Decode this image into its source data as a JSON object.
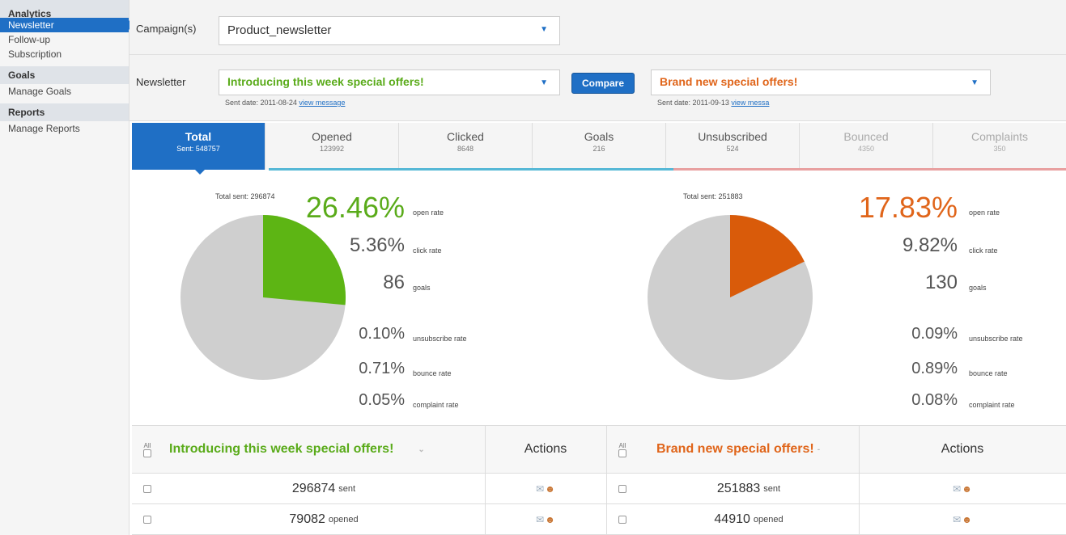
{
  "sidebar": {
    "analytics": "Analytics",
    "analytics_items": [
      "Newsletter",
      "Follow-up",
      "Subscription"
    ],
    "goals": "Goals",
    "goals_items": [
      "Manage Goals"
    ],
    "reports": "Reports",
    "reports_items": [
      "Manage Reports"
    ]
  },
  "campaign": {
    "label": "Campaign(s)",
    "value": "Product_newsletter"
  },
  "newsletter": {
    "label": "Newsletter",
    "left": {
      "value": "Introducing this week special offers!",
      "sent_date": "Sent date: 2011-08-24",
      "view": "view message"
    },
    "compare": "Compare",
    "right": {
      "value": "Brand new special offers!",
      "sent_date": "Sent date: 2011-09-13",
      "view": "view messa"
    }
  },
  "tabs": [
    {
      "label": "Total",
      "sub": "Sent: 548757"
    },
    {
      "label": "Opened",
      "sub": "123992"
    },
    {
      "label": "Clicked",
      "sub": "8648"
    },
    {
      "label": "Goals",
      "sub": "216"
    },
    {
      "label": "Unsubscribed",
      "sub": "524"
    },
    {
      "label": "Bounced",
      "sub": "4350"
    },
    {
      "label": "Complaints",
      "sub": "350"
    }
  ],
  "left_stats": {
    "total_sent": "Total sent: 296874",
    "open_rate": "26.46%",
    "open_rate_label": "open rate",
    "click_rate": "5.36%",
    "click_rate_label": "click rate",
    "goals": "86",
    "goals_label": "goals",
    "unsub_rate": "0.10%",
    "unsub_rate_label": "unsubscribe rate",
    "bounce_rate": "0.71%",
    "bounce_rate_label": "bounce rate",
    "complaint_rate": "0.05%",
    "complaint_rate_label": "complaint rate",
    "pie_fraction": 0.2646,
    "pie_color": "#5db514"
  },
  "right_stats": {
    "total_sent": "Total sent: 251883",
    "open_rate": "17.83%",
    "open_rate_label": "open rate",
    "click_rate": "9.82%",
    "click_rate_label": "click rate",
    "goals": "130",
    "goals_label": "goals",
    "unsub_rate": "0.09%",
    "unsub_rate_label": "unsubscribe rate",
    "bounce_rate": "0.89%",
    "bounce_rate_label": "bounce rate",
    "complaint_rate": "0.08%",
    "complaint_rate_label": "complaint rate",
    "pie_fraction": 0.1783,
    "pie_color": "#d95b0a"
  },
  "table": {
    "all_label": "All",
    "left_title": "Introducing this week special offers!",
    "right_title": "Brand new special offers!",
    "actions": "Actions",
    "rows": [
      {
        "left_num": "296874",
        "left_unit": "sent",
        "right_num": "251883",
        "right_unit": "sent"
      },
      {
        "left_num": "79082",
        "left_unit": "opened",
        "right_num": "44910",
        "right_unit": "opened"
      }
    ]
  }
}
